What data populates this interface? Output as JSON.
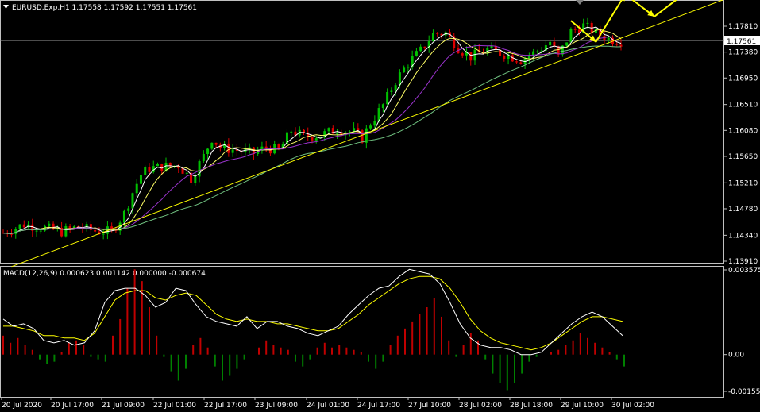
{
  "header": {
    "symbol_line": "EURUSD.Exp,H1  1.17558 1.17592 1.17551 1.17561",
    "indicator_line": "MACD(12,26,9) 0.000623 0.001142 0.000000 -0.000674"
  },
  "colors": {
    "background": "#000000",
    "bull_candle": "#00c000",
    "bear_candle": "#e00000",
    "ma_fast": "#ffffff",
    "ma_mid": "#ffff66",
    "ma_slow": "#9933cc",
    "ma_long": "#6fbf7f",
    "trendline": "#ffff00",
    "arrow": "#ffff00",
    "macd_line": "#ffffff",
    "signal_line": "#ffff00",
    "hist_pos": "#c00000",
    "hist_neg": "#008000",
    "axis": "#c0c0c0"
  },
  "chart_data": [
    {
      "type": "candlestick",
      "symbol": "EURUSD.Exp",
      "timeframe": "H1",
      "ohlc_last": {
        "open": 1.17558,
        "high": 1.17592,
        "low": 1.17551,
        "close": 1.17561
      },
      "current_price": "1.17561",
      "ylim": [
        1.138,
        1.1808
      ],
      "y_ticks": [
        "1.17810",
        "1.17380",
        "1.16950",
        "1.16510",
        "1.16080",
        "1.15650",
        "1.15210",
        "1.14780",
        "1.14340",
        "1.13910"
      ],
      "x_ticks": [
        "20 Jul 2020",
        "20 Jul 17:00",
        "21 Jul 09:00",
        "22 Jul 01:00",
        "22 Jul 17:00",
        "23 Jul 09:00",
        "24 Jul 01:00",
        "24 Jul 17:00",
        "27 Jul 10:00",
        "28 Jul 02:00",
        "28 Jul 18:00",
        "29 Jul 10:00",
        "30 Jul 02:00"
      ],
      "close_path": [
        [
          0,
          1.1438
        ],
        [
          5,
          1.1452
        ],
        [
          10,
          1.1446
        ],
        [
          14,
          1.144
        ],
        [
          18,
          1.1448
        ],
        [
          22,
          1.1441
        ],
        [
          26,
          1.144
        ],
        [
          29,
          1.147
        ],
        [
          31,
          1.1505
        ],
        [
          33,
          1.1535
        ],
        [
          35,
          1.1545
        ],
        [
          38,
          1.1548
        ],
        [
          42,
          1.155
        ],
        [
          45,
          1.1528
        ],
        [
          48,
          1.1565
        ],
        [
          50,
          1.1595
        ],
        [
          52,
          1.158
        ],
        [
          56,
          1.1575
        ],
        [
          60,
          1.157
        ],
        [
          63,
          1.158
        ],
        [
          66,
          1.1574
        ],
        [
          69,
          1.1608
        ],
        [
          72,
          1.1598
        ],
        [
          76,
          1.16
        ],
        [
          80,
          1.161
        ],
        [
          84,
          1.1605
        ],
        [
          86,
          1.1595
        ],
        [
          88,
          1.162
        ],
        [
          91,
          1.165
        ],
        [
          94,
          1.169
        ],
        [
          97,
          1.172
        ],
        [
          100,
          1.174
        ],
        [
          103,
          1.1768
        ],
        [
          106,
          1.177
        ],
        [
          109,
          1.1745
        ],
        [
          112,
          1.173
        ],
        [
          116,
          1.1742
        ],
        [
          120,
          1.1735
        ],
        [
          124,
          1.1725
        ],
        [
          128,
          1.174
        ],
        [
          131,
          1.1755
        ],
        [
          133,
          1.173
        ],
        [
          136,
          1.1772
        ],
        [
          139,
          1.1782
        ],
        [
          142,
          1.177
        ],
        [
          145,
          1.176
        ],
        [
          148,
          1.1756
        ]
      ],
      "moving_averages": [
        "ma_fast",
        "ma_mid",
        "ma_slow",
        "ma_long"
      ],
      "trendline": {
        "from": [
          2,
          1.1382
        ],
        "to": [
          176,
          1.1834
        ]
      },
      "forecast_arrows": [
        {
          "from": [
            136,
            1.179
          ],
          "to": [
            142,
            1.1755
          ]
        },
        {
          "from": [
            142,
            1.1755
          ],
          "to": [
            149,
            1.1834
          ]
        },
        {
          "from": [
            149,
            1.1834
          ],
          "to": [
            156,
            1.1797
          ]
        },
        {
          "from": [
            156,
            1.1797
          ],
          "to": [
            166,
            1.185
          ]
        }
      ]
    },
    {
      "type": "bar",
      "name": "MACD(12,26,9)",
      "values_printed": {
        "macd": "0.000623",
        "signal": "0.001142",
        "v3": "0.000000",
        "v4": "-0.000674"
      },
      "ylim": [
        -0.001552,
        0.003575
      ],
      "y_ticks": [
        "0.003575",
        "0.00",
        "-0.001552"
      ],
      "histogram": [
        0.0008,
        0.0005,
        0.0007,
        0.0004,
        0.0002,
        -0.0002,
        -0.0004,
        -0.0003,
        0.0001,
        0.0005,
        0.0006,
        0.0004,
        -0.0001,
        -0.0002,
        -0.0003,
        0.0008,
        0.0015,
        0.0028,
        0.0036,
        0.0031,
        0.002,
        0.0008,
        -0.0001,
        -0.0007,
        -0.0011,
        -0.0006,
        0.0004,
        0.0007,
        0.0003,
        -0.0005,
        -0.0011,
        -0.0009,
        -0.0006,
        -0.0002,
        0.0,
        0.0003,
        0.0006,
        0.0004,
        0.0003,
        0.0002,
        -0.0003,
        -0.0005,
        -0.0002,
        0.0003,
        0.0005,
        0.0003,
        0.0004,
        0.0003,
        0.0002,
        0.0001,
        -0.0003,
        -0.0006,
        -0.0003,
        0.0004,
        0.0008,
        0.0011,
        0.0014,
        0.0017,
        0.002,
        0.0024,
        0.0016,
        0.0006,
        -0.0001,
        0.0004,
        0.0009,
        0.0006,
        -0.0002,
        -0.0008,
        -0.0012,
        -0.0015,
        -0.0012,
        -0.0008,
        -0.0003,
        -0.0001,
        0.0,
        0.0001,
        0.0002,
        0.0004,
        0.0006,
        0.0009,
        0.0007,
        0.0005,
        0.0003,
        0.0001,
        -0.0002,
        -0.0005
      ],
      "macd_line": [
        0.0015,
        0.0012,
        0.0013,
        0.0011,
        0.0006,
        0.0005,
        0.0006,
        0.0004,
        0.0005,
        0.001,
        0.0022,
        0.0027,
        0.0028,
        0.0028,
        0.0025,
        0.002,
        0.0022,
        0.0028,
        0.0027,
        0.0021,
        0.0016,
        0.0014,
        0.0013,
        0.0012,
        0.0016,
        0.0011,
        0.0014,
        0.0014,
        0.0012,
        0.0011,
        0.0009,
        0.0008,
        0.001,
        0.0012,
        0.0017,
        0.0021,
        0.0025,
        0.0028,
        0.0029,
        0.0033,
        0.0036,
        0.0035,
        0.0034,
        0.003,
        0.0022,
        0.0013,
        0.0007,
        0.0004,
        0.0003,
        0.0003,
        0.0002,
        0.0,
        0.0,
        0.0001,
        0.0005,
        0.0009,
        0.0013,
        0.0016,
        0.0018,
        0.0016,
        0.0012,
        0.0008
      ],
      "signal_line": [
        0.0012,
        0.0012,
        0.0011,
        0.001,
        0.0008,
        0.0008,
        0.0007,
        0.0007,
        0.0006,
        0.0009,
        0.0016,
        0.0023,
        0.0026,
        0.0027,
        0.0027,
        0.0024,
        0.0023,
        0.0025,
        0.0026,
        0.0025,
        0.0021,
        0.0017,
        0.0015,
        0.0014,
        0.0015,
        0.0014,
        0.0014,
        0.0013,
        0.0013,
        0.0012,
        0.0011,
        0.001,
        0.001,
        0.0011,
        0.0014,
        0.0017,
        0.0021,
        0.0024,
        0.0027,
        0.003,
        0.0032,
        0.0033,
        0.0033,
        0.0032,
        0.0028,
        0.0022,
        0.0015,
        0.001,
        0.0007,
        0.0005,
        0.0004,
        0.0003,
        0.0002,
        0.0003,
        0.0005,
        0.0008,
        0.0011,
        0.0014,
        0.0016,
        0.0016,
        0.0015,
        0.0014
      ]
    }
  ]
}
